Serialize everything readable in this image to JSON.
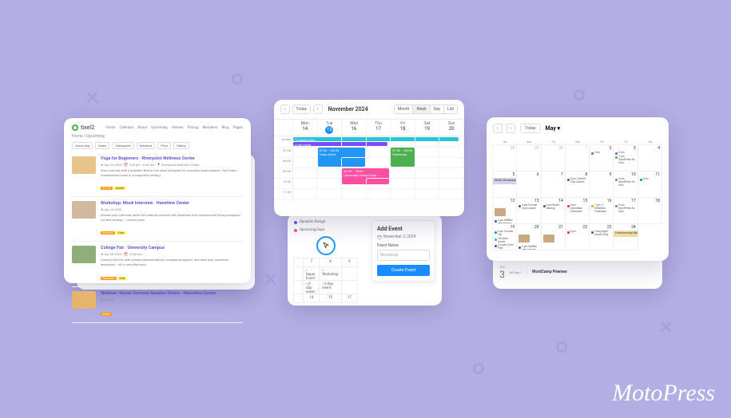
{
  "logo_text": "MotoPress",
  "left": {
    "brand": "tixel2",
    "nav": [
      "Home",
      "Calendar",
      "About",
      "Upcoming",
      "Venues",
      "Pricing",
      "Members",
      "Blog",
      "Pages"
    ],
    "heading": "Home / Upcoming",
    "filters": [
      "Upcoming",
      "Dates",
      "Categories",
      "Distance",
      "Price",
      "Rating"
    ],
    "items": [
      {
        "title": "Yoga for Beginners · Riverpoint Wellness Center",
        "meta": "★ Apr 20 2024 · ⏰ 7:00 am - 8:30 am · 📍 Riverpoint Wellness Center",
        "desc": "Start your day with a peaceful flow in this class designed for complete yoga newbies. You'll learn foundational poses in a supportive setting.",
        "tags": [
          "$15.00",
          "Health"
        ],
        "thumb": "#e6c48a"
      },
      {
        "title": "Workshop: Mock Interview · Hazeltine Center",
        "meta": "★ Apr 24 2024",
        "desc": "Elevate your interview skills! Get realistic practice with feedback from experienced hiring managers. Limited seating — reserve early.",
        "tags": [
          "Business",
          "Free"
        ],
        "thumb": "#d3b8a0"
      },
      {
        "title": "College Fair · University Campus",
        "meta": "★ Apr 26 2024 · ⏰ 10:00 am",
        "desc": "Connect directly with college representatives, compare programs, and have your questions answered — all in one afternoon.",
        "tags": [
          "Education",
          "Free"
        ],
        "thumb": "#8fae7a"
      },
      {
        "title": "Webinar: Social Services Speaker Series · Hazeltine Center",
        "meta": "★ Apr 28",
        "desc": "",
        "tags": [
          "Online"
        ],
        "thumb": "#e8b36a"
      }
    ]
  },
  "center_front": {
    "today": "Today",
    "title": "November 2024",
    "views": [
      "Month",
      "Week",
      "Day",
      "List"
    ],
    "dows": [
      "Mon",
      "Tue",
      "Wed",
      "Thu",
      "Fri",
      "Sat",
      "Sun"
    ],
    "dates": [
      "14",
      "15",
      "16",
      "17",
      "18",
      "19",
      "20"
    ],
    "allday_label": "All-day",
    "times": [
      "07:00",
      "08:00",
      "09:00",
      "10:00",
      "11:00"
    ],
    "events": {
      "allday_month": "1-month event",
      "allday_4day": "4-day event",
      "blue": "07:00 – 08:00\n2-day event",
      "green": "07:00 – 08:00\nWorkshop",
      "pink": "08:00 – 10:00\nUpcoming Design Expo"
    }
  },
  "center_back": {
    "rows": [
      {
        "color": "#7c4dff",
        "label": "Dynamic Design"
      },
      {
        "color": "#ff4fa3",
        "label": "Upcoming Expo"
      }
    ],
    "grid_head": [
      "7",
      "8",
      "9"
    ],
    "grid_ev": [
      [
        "Super Event",
        "Workshop"
      ],
      [
        "2-day event",
        "3-day event"
      ]
    ],
    "grid_foot": [
      "14",
      "15",
      "17"
    ],
    "panel": {
      "title": "Add Event",
      "date": "November 2, 2024",
      "name_label": "Event Name",
      "name_ph": "Workshop",
      "create": "Create Event"
    }
  },
  "right_front": {
    "today": "Today",
    "month": "May",
    "dows": [
      "Su",
      "Mo",
      "Tu",
      "We",
      "Th",
      "Fr",
      "Sa"
    ],
    "cells": [
      {
        "d": "28",
        "mut": true
      },
      {
        "d": "29",
        "mut": true
      },
      {
        "d": "30",
        "mut": true
      },
      {
        "d": "1",
        "mut": true
      },
      {
        "d": "2",
        "ev": [
          {
            "c": "#7c4dff",
            "t": "8 am"
          }
        ]
      },
      {
        "d": "3",
        "ev": [
          {
            "c": "#7c4dff",
            "t": "8 am"
          },
          {
            "c": "#4caf50",
            "t": "9 am WordPress for Kids"
          }
        ]
      },
      {
        "d": "4"
      },
      {
        "d": "5"
      },
      {
        "d": "6"
      },
      {
        "d": "7"
      },
      {
        "d": "8",
        "ev": [
          {
            "c": "#3f51b5",
            "t": "6 pm Crochet Club Launch"
          }
        ]
      },
      {
        "d": "9"
      },
      {
        "d": "10",
        "ev": [
          {
            "c": "#4caf50",
            "t": "8 am WordPress for Kids"
          }
        ]
      },
      {
        "d": "11",
        "ev": [
          {
            "c": "#009688",
            "t": "8 am"
          }
        ]
      },
      {
        "d": "12",
        "ev": [
          {
            "c": "#3f51b5",
            "t": "6 pm Waffles with Friends"
          }
        ],
        "thumb": "#caa882"
      },
      {
        "d": "13",
        "ev": [
          {
            "c": "#3f51b5",
            "t": "6 pm Crochet Club Launch"
          }
        ]
      },
      {
        "d": "14",
        "ev": [
          {
            "c": "#3f51b5",
            "t": "6 pm Board Gaming"
          }
        ]
      },
      {
        "d": "15",
        "ev": [
          {
            "c": "#e91e63",
            "t": "8 am CarrotMan Downtown"
          }
        ]
      },
      {
        "d": "16",
        "ev": [
          {
            "c": "#ff9800",
            "t": "7 pm LF Breakfast Fundraiser"
          }
        ]
      },
      {
        "d": "17",
        "ev": [
          {
            "c": "#4caf50",
            "t": "8 am WordPress for Kids"
          }
        ]
      },
      {
        "d": "18"
      },
      {
        "d": "19",
        "ev": [
          {
            "c": "#009688",
            "t": "6 pm Crochet Fair"
          },
          {
            "c": "#00bcd4",
            "t": "1M Open House"
          },
          {
            "c": "#673ab7",
            "t": "Concert in the Park"
          }
        ]
      },
      {
        "d": "20",
        "ev": [
          {
            "c": "#3f51b5",
            "t": "6 pm Waffles with Friends"
          }
        ],
        "thumb": "#caa882"
      },
      {
        "d": "21",
        "thumb": "#caa882"
      },
      {
        "d": "22",
        "ev": [
          {
            "c": "#e91e63",
            "t": "8 pm"
          }
        ]
      },
      {
        "d": "23",
        "ev": [
          {
            "c": "#673ab7",
            "t": "Funky Night Dance Party"
          }
        ]
      },
      {
        "d": "24"
      }
    ],
    "band1": "Winter Renaissance Fair",
    "band2": "Homecoming Weekend"
  },
  "right_back": {
    "dow": "Thu",
    "num": "3",
    "allday": "All Day »",
    "event": "WordCamp Pawnee"
  }
}
